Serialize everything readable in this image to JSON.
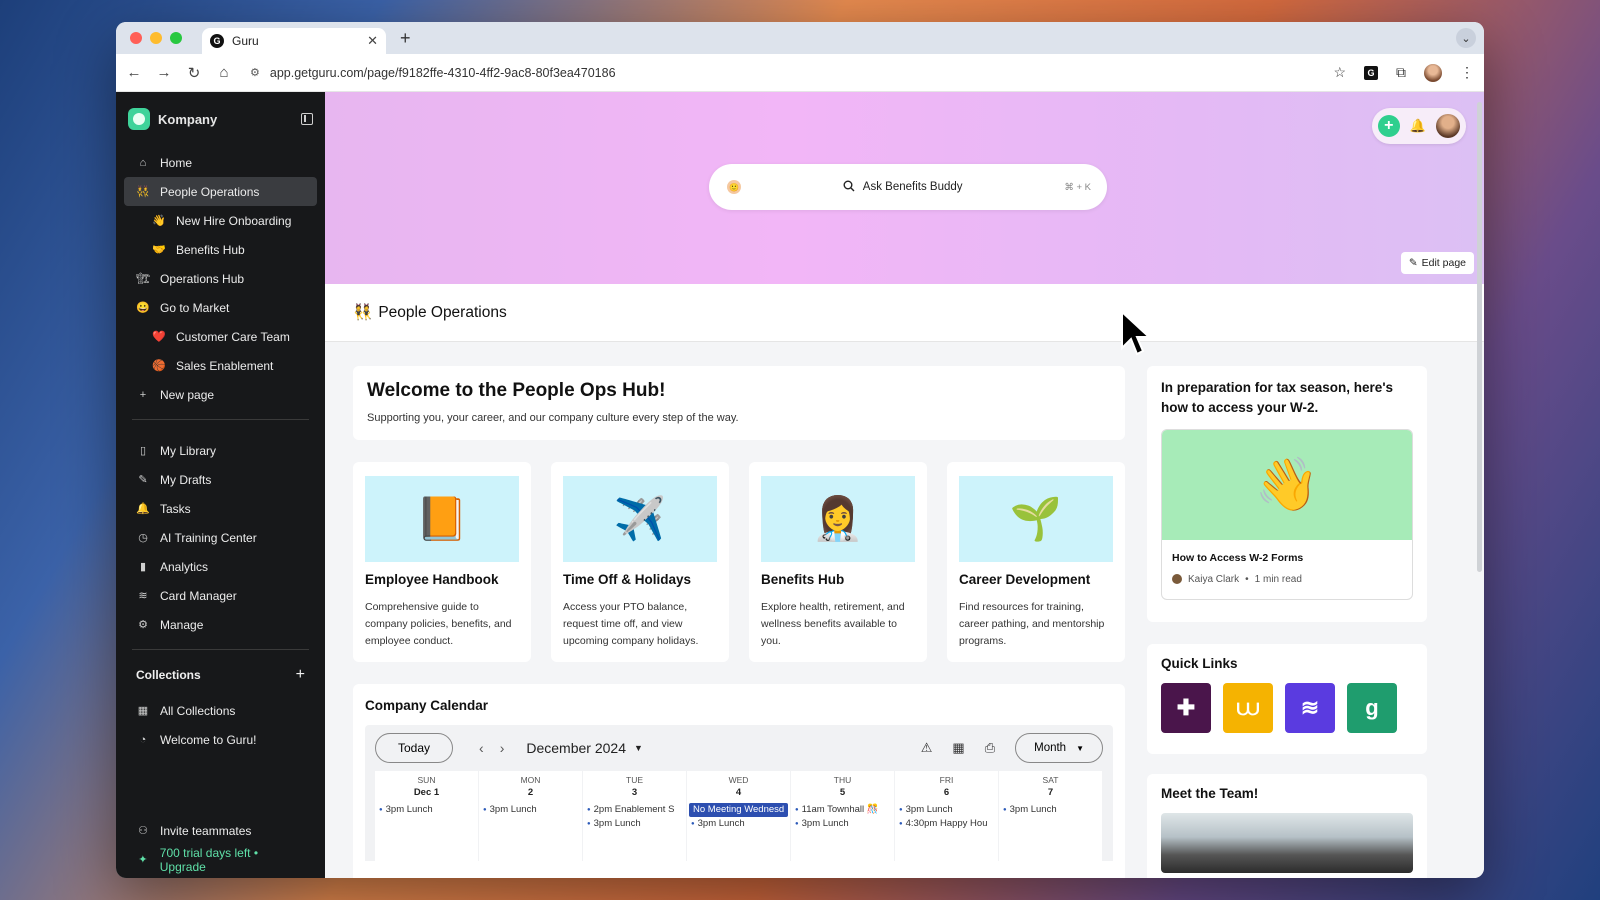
{
  "browser": {
    "tab_title": "Guru",
    "tab_favicon": "G",
    "url": "app.getguru.com/page/f9182ffe-4310-4ff2-9ac8-80f3ea470186",
    "ext_label": "G",
    "traffic_lights": [
      "#ff5f57",
      "#febc2e",
      "#28c840"
    ]
  },
  "sidebar": {
    "workspace": "Kompany",
    "items": [
      {
        "label": "Home",
        "icon": "⌂",
        "icon_name": "home-icon",
        "sub": false,
        "active": false
      },
      {
        "label": "People Operations",
        "icon": "👯",
        "icon_name": "people-emoji-icon",
        "sub": false,
        "active": true
      },
      {
        "label": "New Hire Onboarding",
        "icon": "👋",
        "icon_name": "wave-emoji-icon",
        "sub": true,
        "active": false
      },
      {
        "label": "Benefits Hub",
        "icon": "🤝",
        "icon_name": "handshake-emoji-icon",
        "sub": true,
        "active": false
      },
      {
        "label": "Operations Hub",
        "icon": "🏗",
        "icon_name": "crane-emoji-icon",
        "sub": false,
        "active": false
      },
      {
        "label": "Go to Market",
        "icon": "😀",
        "icon_name": "smile-emoji-icon",
        "sub": false,
        "active": false
      },
      {
        "label": "Customer Care Team",
        "icon": "❤️",
        "icon_name": "heart-emoji-icon",
        "sub": true,
        "active": false
      },
      {
        "label": "Sales Enablement",
        "icon": "🏀",
        "icon_name": "basketball-emoji-icon",
        "sub": true,
        "active": false
      },
      {
        "label": "New page",
        "icon": "+",
        "icon_name": "plus-icon",
        "sub": false,
        "active": false
      }
    ],
    "tools": [
      {
        "label": "My Library",
        "icon": "▯",
        "icon_name": "bookmark-icon"
      },
      {
        "label": "My Drafts",
        "icon": "✎",
        "icon_name": "drafts-icon"
      },
      {
        "label": "Tasks",
        "icon": "🔔",
        "icon_name": "bell-icon"
      },
      {
        "label": "AI Training Center",
        "icon": "◷",
        "icon_name": "ai-training-icon"
      },
      {
        "label": "Analytics",
        "icon": "▮",
        "icon_name": "analytics-icon"
      },
      {
        "label": "Card Manager",
        "icon": "≋",
        "icon_name": "layers-icon"
      },
      {
        "label": "Manage",
        "icon": "⚙",
        "icon_name": "gear-icon"
      }
    ],
    "collections_title": "Collections",
    "collections": [
      {
        "label": "All Collections",
        "icon": "▦",
        "icon_name": "grid-icon"
      },
      {
        "label": "Welcome to Guru!",
        "icon": "◔",
        "icon_name": "guru-collection-icon"
      }
    ],
    "invite": "Invite teammates",
    "trial": "700 trial days left • Upgrade"
  },
  "hero": {
    "search_placeholder": "Ask Benefits Buddy",
    "search_shortcut": "⌘ + K",
    "edit_page": "Edit page"
  },
  "page": {
    "title_emoji": "👯",
    "title": "People Operations",
    "welcome_title": "Welcome to the People Ops Hub!",
    "welcome_sub": "Supporting you, your career, and our company culture every step of the way."
  },
  "hubs": [
    {
      "emoji": "📙",
      "title": "Employee Handbook",
      "desc": "Comprehensive guide to company policies, benefits, and employee conduct."
    },
    {
      "emoji": "✈️",
      "title": "Time Off & Holidays",
      "desc": "Access your PTO balance, request time off, and view upcoming company holidays."
    },
    {
      "emoji": "👩‍⚕️",
      "title": "Benefits Hub",
      "desc": "Explore health, retirement, and wellness benefits available to you."
    },
    {
      "emoji": "🌱",
      "title": "Career Development",
      "desc": "Find resources for training, career pathing, and mentorship programs."
    }
  ],
  "calendar": {
    "title": "Company Calendar",
    "today": "Today",
    "month": "December 2024",
    "view": "Month",
    "days": [
      {
        "dow": "SUN",
        "date": "Dec 1",
        "events": [
          {
            "text": "3pm Lunch",
            "hl": false
          }
        ]
      },
      {
        "dow": "MON",
        "date": "2",
        "events": [
          {
            "text": "3pm Lunch",
            "hl": false
          }
        ]
      },
      {
        "dow": "TUE",
        "date": "3",
        "events": [
          {
            "text": "2pm Enablement S",
            "hl": false
          },
          {
            "text": "3pm Lunch",
            "hl": false
          }
        ]
      },
      {
        "dow": "WED",
        "date": "4",
        "events": [
          {
            "text": "No Meeting Wednesd",
            "hl": true
          },
          {
            "text": "3pm Lunch",
            "hl": false
          }
        ]
      },
      {
        "dow": "THU",
        "date": "5",
        "events": [
          {
            "text": "11am Townhall 🎊",
            "hl": false
          },
          {
            "text": "3pm Lunch",
            "hl": false
          }
        ]
      },
      {
        "dow": "FRI",
        "date": "6",
        "events": [
          {
            "text": "3pm Lunch",
            "hl": false
          },
          {
            "text": "4:30pm Happy Hou",
            "hl": false
          }
        ]
      },
      {
        "dow": "SAT",
        "date": "7",
        "events": [
          {
            "text": "3pm Lunch",
            "hl": false
          }
        ]
      }
    ]
  },
  "tax": {
    "title": "In preparation for tax season, here's how to access your W-2.",
    "emoji": "👋",
    "link": "How to Access W-2 Forms",
    "author": "Kaiya Clark",
    "read": "1 min read"
  },
  "quick_links": {
    "title": "Quick Links",
    "tiles": [
      {
        "name": "slack",
        "glyph": "✚",
        "bg": "#4a154b"
      },
      {
        "name": "app-orange",
        "glyph": "⩊",
        "bg": "#f5b301"
      },
      {
        "name": "app-purple",
        "glyph": "≋",
        "bg": "#5a3be0"
      },
      {
        "name": "guru",
        "glyph": "g",
        "bg": "#1f9d6e"
      }
    ]
  },
  "team": {
    "title": "Meet the Team!"
  },
  "colors": {
    "accent": "#2fcf8e",
    "trial": "#5fe0a8",
    "event_dot": "#2d5bb9"
  }
}
